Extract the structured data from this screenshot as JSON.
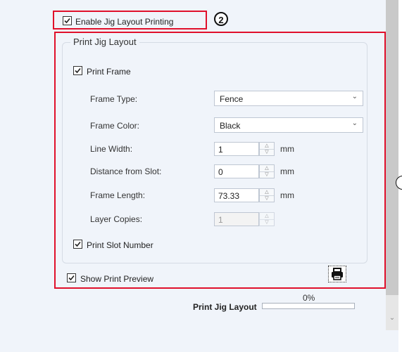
{
  "enable_jig_layout_printing": {
    "label": "Enable Jig Layout Printing",
    "checked": true
  },
  "annotation": "2",
  "group": {
    "title": "Print Jig Layout",
    "print_frame": {
      "label": "Print Frame",
      "checked": true
    },
    "frame_type": {
      "label": "Frame Type:",
      "value": "Fence"
    },
    "frame_color": {
      "label": "Frame Color:",
      "value": "Black"
    },
    "line_width": {
      "label": "Line Width:",
      "value": "1",
      "unit": "mm"
    },
    "distance_from_slot": {
      "label": "Distance from Slot:",
      "value": "0",
      "unit": "mm"
    },
    "frame_length": {
      "label": "Frame Length:",
      "value": "73.33",
      "unit": "mm"
    },
    "layer_copies": {
      "label": "Layer Copies:",
      "value": "1"
    },
    "print_slot_number": {
      "label": "Print Slot Number",
      "checked": true
    }
  },
  "show_print_preview": {
    "label": "Show Print Preview",
    "checked": true
  },
  "print_icon": "printer-icon",
  "progress": {
    "percent_text": "0%",
    "label": "Print Jig Layout",
    "fraction": 0
  },
  "colors": {
    "highlight": "#e0102b",
    "background": "#f0f4fa"
  }
}
